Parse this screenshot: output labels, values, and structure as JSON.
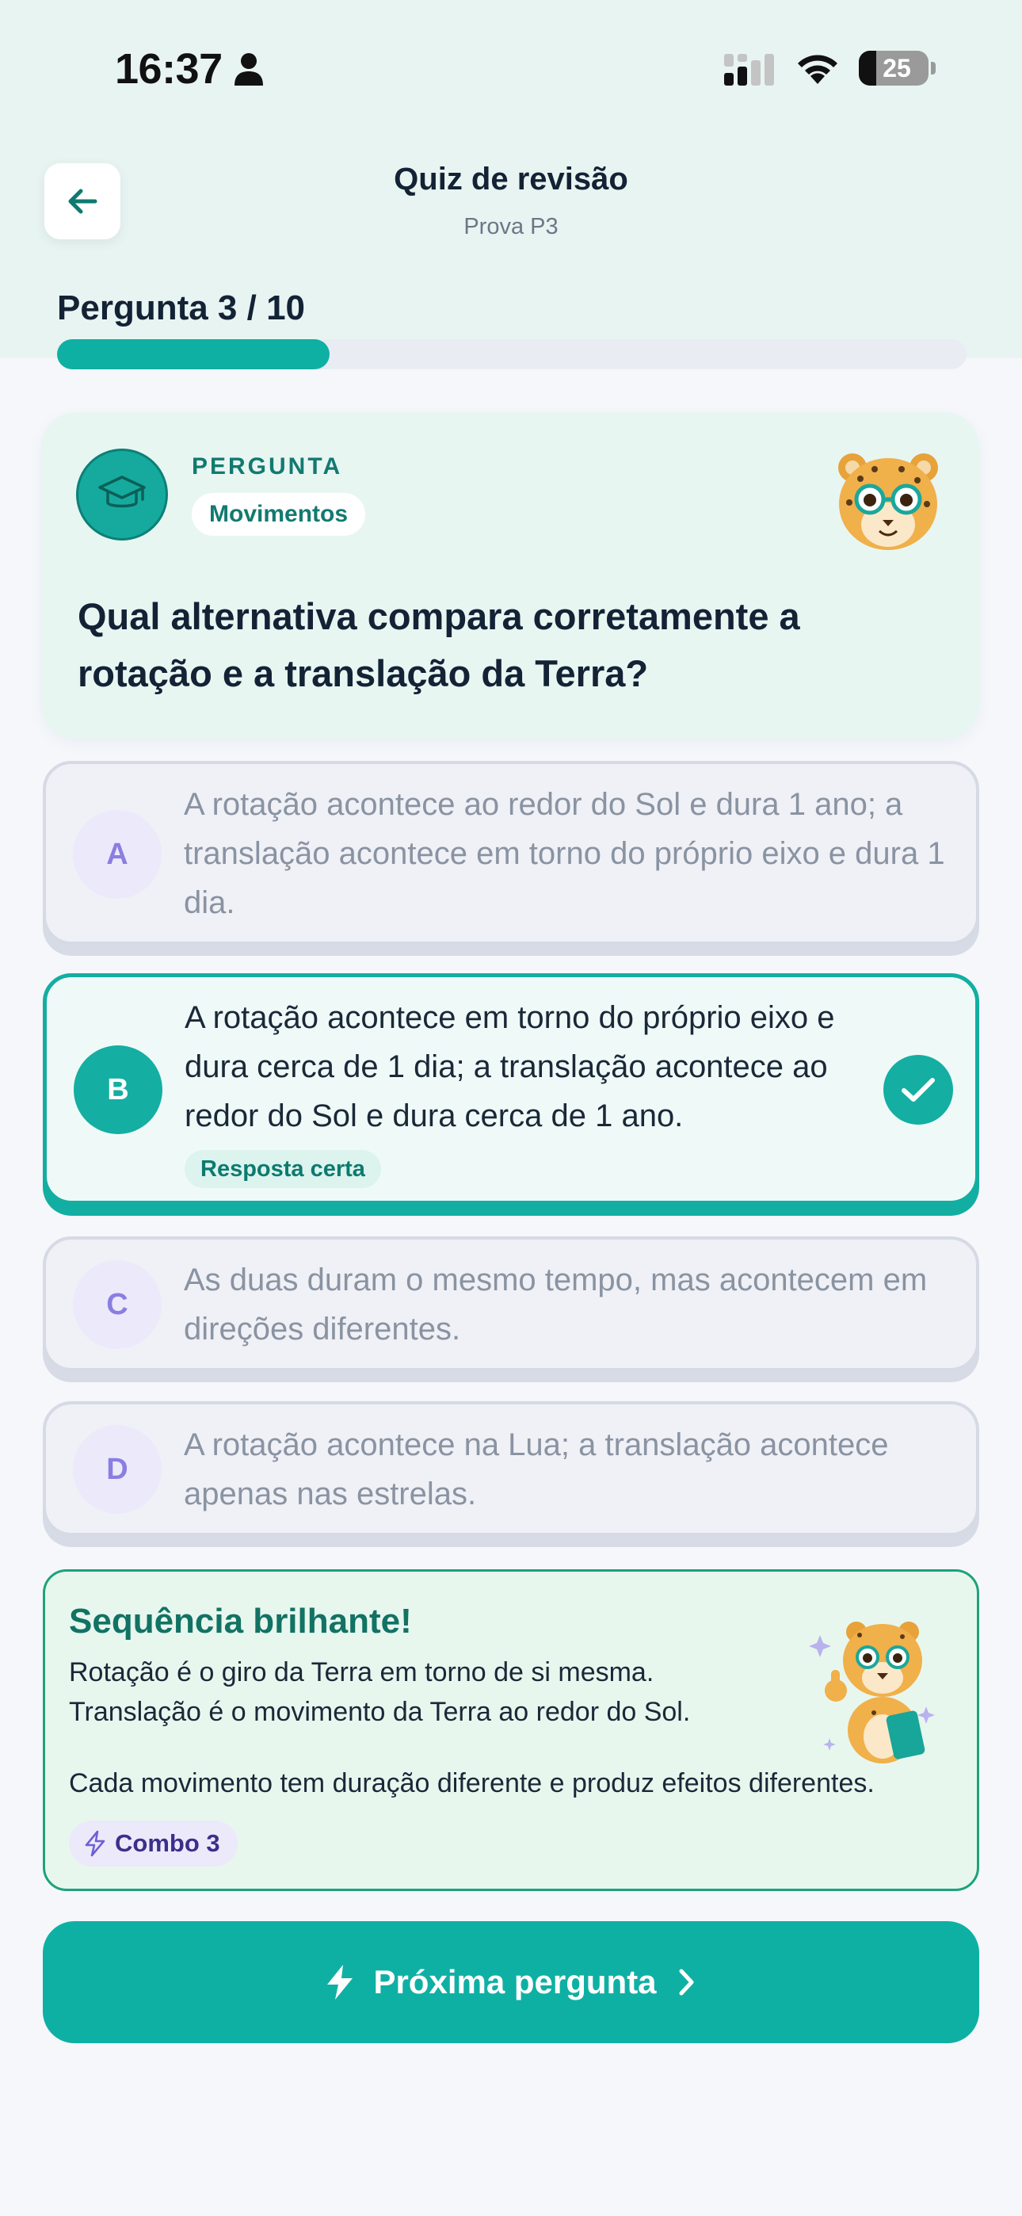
{
  "status_bar": {
    "time": "16:37",
    "battery_percent": "25",
    "battery_level": 0.25
  },
  "header": {
    "title": "Quiz de revisão",
    "subtitle": "Prova P3",
    "back_icon": "arrow-left-icon"
  },
  "progress": {
    "label": "Pergunta 3 / 10",
    "fraction": 0.3
  },
  "question": {
    "kicker": "PERGUNTA",
    "topic": "Movimentos",
    "text": "Qual alternativa compara corretamente a rotação e a translação da Terra?",
    "icon": "graduation-cap-icon",
    "mascot": "cheetah-mascot"
  },
  "options": [
    {
      "letter": "A",
      "text": "A rotação acontece ao redor do Sol e dura 1 ano; a translação acontece em torno do próprio eixo e dura 1 dia.",
      "correct": false
    },
    {
      "letter": "B",
      "text": "A rotação acontece em torno do próprio eixo e dura cerca de 1 dia; a translação acontece ao redor do Sol e dura cerca de 1 ano.",
      "correct": true,
      "badge": "Resposta certa"
    },
    {
      "letter": "C",
      "text": "As duas duram o mesmo tempo, mas acontecem em direções diferentes.",
      "correct": false
    },
    {
      "letter": "D",
      "text": "A rotação acontece na Lua; a translação acontece apenas nas estrelas.",
      "correct": false
    }
  ],
  "feedback": {
    "title": "Sequência brilhante!",
    "line1": "Rotação é o giro da Terra em torno de si mesma.",
    "line2": "Translação é o movimento da Terra ao redor do Sol.",
    "line3": "Cada movimento tem duração diferente e produz efeitos diferentes.",
    "combo": "Combo 3"
  },
  "next_button": {
    "label": "Próxima pergunta"
  },
  "colors": {
    "accent": "#0fb0a4",
    "header_bg": "#e8f4f1",
    "feedback_border": "#1da27a",
    "combo_text": "#3c2f8a"
  }
}
